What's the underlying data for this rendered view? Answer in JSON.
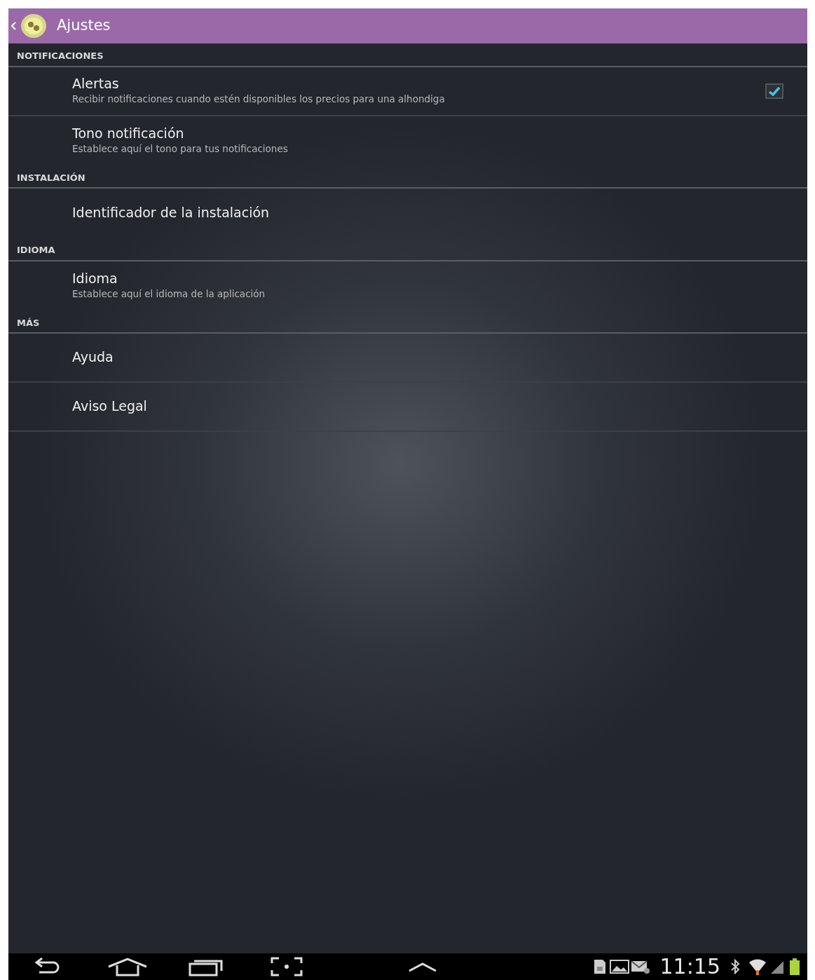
{
  "action_bar": {
    "title": "Ajustes"
  },
  "sections": [
    {
      "header": "NOTIFICACIONES",
      "items": [
        {
          "kind": "checkbox",
          "title": "Alertas",
          "summary": "Recibir notificaciones cuando estén disponibles los precios para una alhondiga",
          "checked": true
        },
        {
          "kind": "plain",
          "title": "Tono notificación",
          "summary": "Establece aquí el tono para tus notificaciones"
        }
      ]
    },
    {
      "header": "INSTALACIÓN",
      "items": [
        {
          "kind": "plain",
          "title": "Identificador de la instalación"
        }
      ]
    },
    {
      "header": "IDIOMA",
      "items": [
        {
          "kind": "plain",
          "title": "Idioma",
          "summary": "Establece aquí el idioma de la aplicación"
        }
      ]
    },
    {
      "header": "MÁS",
      "items": [
        {
          "kind": "plain",
          "title": "Ayuda"
        },
        {
          "kind": "plain",
          "title": "Aviso Legal"
        }
      ]
    }
  ],
  "status_bar": {
    "time": "11:15"
  }
}
